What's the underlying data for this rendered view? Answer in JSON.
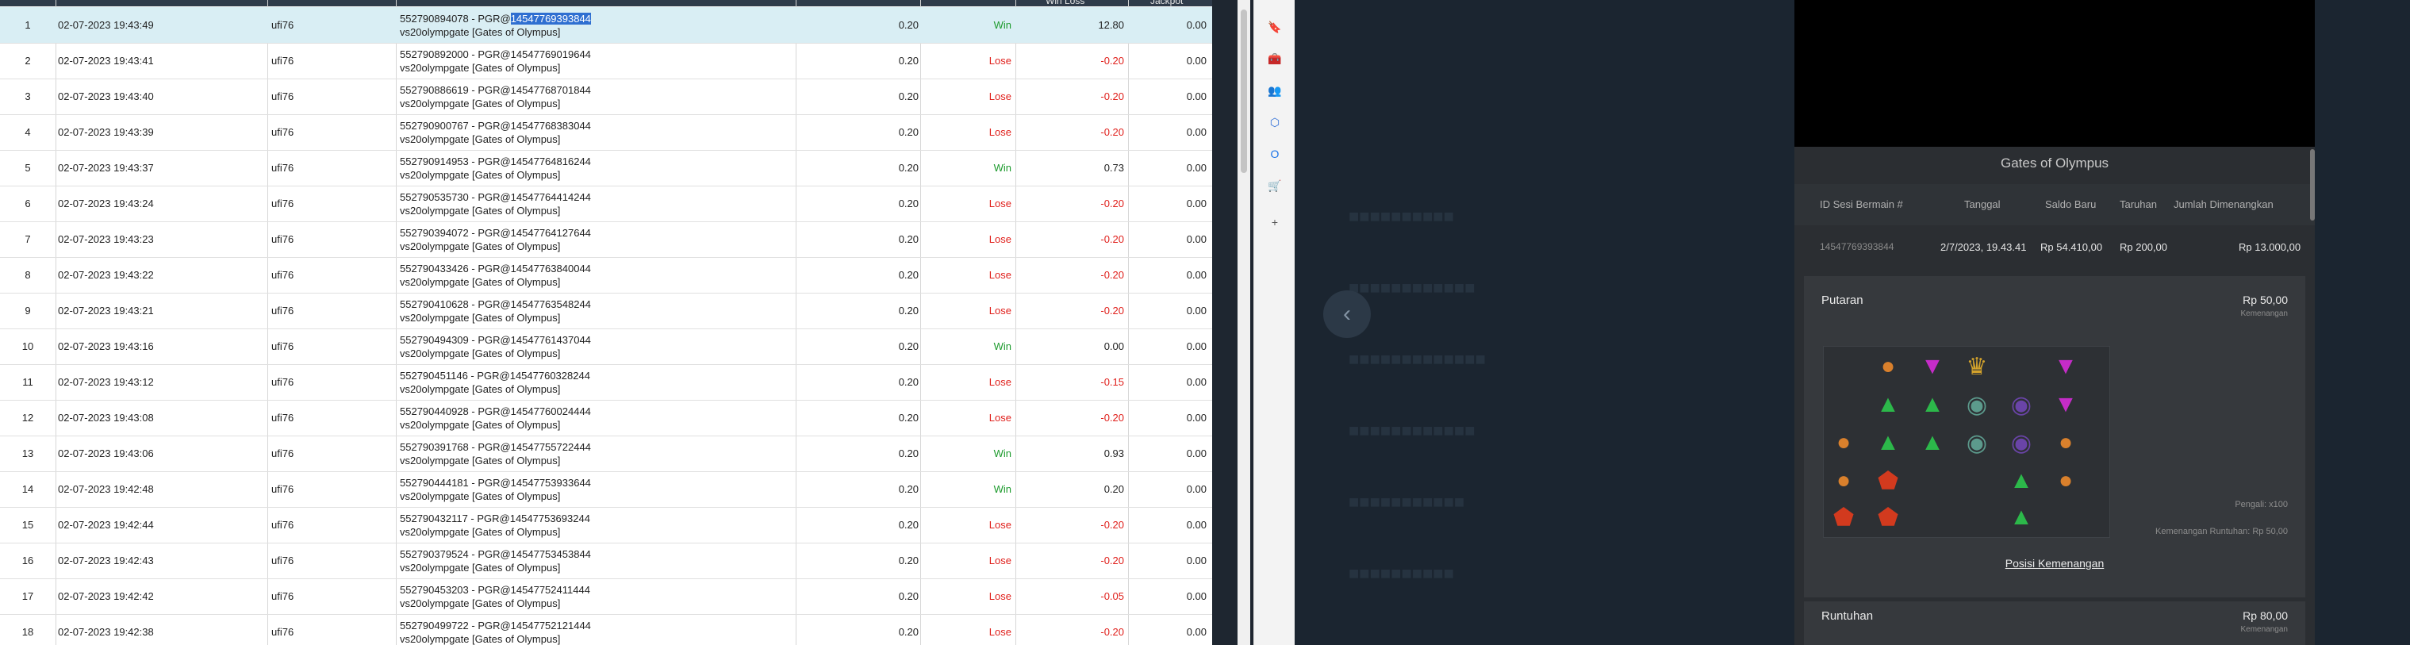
{
  "table": {
    "header": {
      "win_label": "Win Loss",
      "jp_label": "Jackpot"
    },
    "rows": [
      {
        "no": "1",
        "date": "02-07-2023 19:43:49",
        "user": "ufi76",
        "tx_pre": "552790894078 - PGR@",
        "tx_hl": "14547769393844",
        "tx2": "vs20olympgate [Gates of Olympus]",
        "bet": "0.20",
        "status": "Win",
        "win": "12.80",
        "jp": "0.00"
      },
      {
        "no": "2",
        "date": "02-07-2023 19:43:41",
        "user": "ufi76",
        "tx_pre": "552790892000 - PGR@14547769019644",
        "tx_hl": "",
        "tx2": "vs20olympgate [Gates of Olympus]",
        "bet": "0.20",
        "status": "Lose",
        "win": "-0.20",
        "jp": "0.00"
      },
      {
        "no": "3",
        "date": "02-07-2023 19:43:40",
        "user": "ufi76",
        "tx_pre": "552790886619 - PGR@14547768701844",
        "tx_hl": "",
        "tx2": "vs20olympgate [Gates of Olympus]",
        "bet": "0.20",
        "status": "Lose",
        "win": "-0.20",
        "jp": "0.00"
      },
      {
        "no": "4",
        "date": "02-07-2023 19:43:39",
        "user": "ufi76",
        "tx_pre": "552790900767 - PGR@14547768383044",
        "tx_hl": "",
        "tx2": "vs20olympgate [Gates of Olympus]",
        "bet": "0.20",
        "status": "Lose",
        "win": "-0.20",
        "jp": "0.00"
      },
      {
        "no": "5",
        "date": "02-07-2023 19:43:37",
        "user": "ufi76",
        "tx_pre": "552790914953 - PGR@14547764816244",
        "tx_hl": "",
        "tx2": "vs20olympgate [Gates of Olympus]",
        "bet": "0.20",
        "status": "Win",
        "win": "0.73",
        "jp": "0.00"
      },
      {
        "no": "6",
        "date": "02-07-2023 19:43:24",
        "user": "ufi76",
        "tx_pre": "552790535730 - PGR@14547764414244",
        "tx_hl": "",
        "tx2": "vs20olympgate [Gates of Olympus]",
        "bet": "0.20",
        "status": "Lose",
        "win": "-0.20",
        "jp": "0.00"
      },
      {
        "no": "7",
        "date": "02-07-2023 19:43:23",
        "user": "ufi76",
        "tx_pre": "552790394072 - PGR@14547764127644",
        "tx_hl": "",
        "tx2": "vs20olympgate [Gates of Olympus]",
        "bet": "0.20",
        "status": "Lose",
        "win": "-0.20",
        "jp": "0.00"
      },
      {
        "no": "8",
        "date": "02-07-2023 19:43:22",
        "user": "ufi76",
        "tx_pre": "552790433426 - PGR@14547763840044",
        "tx_hl": "",
        "tx2": "vs20olympgate [Gates of Olympus]",
        "bet": "0.20",
        "status": "Lose",
        "win": "-0.20",
        "jp": "0.00"
      },
      {
        "no": "9",
        "date": "02-07-2023 19:43:21",
        "user": "ufi76",
        "tx_pre": "552790410628 - PGR@14547763548244",
        "tx_hl": "",
        "tx2": "vs20olympgate [Gates of Olympus]",
        "bet": "0.20",
        "status": "Lose",
        "win": "-0.20",
        "jp": "0.00"
      },
      {
        "no": "10",
        "date": "02-07-2023 19:43:16",
        "user": "ufi76",
        "tx_pre": "552790494309 - PGR@14547761437044",
        "tx_hl": "",
        "tx2": "vs20olympgate [Gates of Olympus]",
        "bet": "0.20",
        "status": "Win",
        "win": "0.00",
        "jp": "0.00"
      },
      {
        "no": "11",
        "date": "02-07-2023 19:43:12",
        "user": "ufi76",
        "tx_pre": "552790451146 - PGR@14547760328244",
        "tx_hl": "",
        "tx2": "vs20olympgate [Gates of Olympus]",
        "bet": "0.20",
        "status": "Lose",
        "win": "-0.15",
        "jp": "0.00"
      },
      {
        "no": "12",
        "date": "02-07-2023 19:43:08",
        "user": "ufi76",
        "tx_pre": "552790440928 - PGR@14547760024444",
        "tx_hl": "",
        "tx2": "vs20olympgate [Gates of Olympus]",
        "bet": "0.20",
        "status": "Lose",
        "win": "-0.20",
        "jp": "0.00"
      },
      {
        "no": "13",
        "date": "02-07-2023 19:43:06",
        "user": "ufi76",
        "tx_pre": "552790391768 - PGR@14547755722444",
        "tx_hl": "",
        "tx2": "vs20olympgate [Gates of Olympus]",
        "bet": "0.20",
        "status": "Win",
        "win": "0.93",
        "jp": "0.00"
      },
      {
        "no": "14",
        "date": "02-07-2023 19:42:48",
        "user": "ufi76",
        "tx_pre": "552790444181 - PGR@14547753933644",
        "tx_hl": "",
        "tx2": "vs20olympgate [Gates of Olympus]",
        "bet": "0.20",
        "status": "Win",
        "win": "0.20",
        "jp": "0.00"
      },
      {
        "no": "15",
        "date": "02-07-2023 19:42:44",
        "user": "ufi76",
        "tx_pre": "552790432117 - PGR@14547753693244",
        "tx_hl": "",
        "tx2": "vs20olympgate [Gates of Olympus]",
        "bet": "0.20",
        "status": "Lose",
        "win": "-0.20",
        "jp": "0.00"
      },
      {
        "no": "16",
        "date": "02-07-2023 19:42:43",
        "user": "ufi76",
        "tx_pre": "552790379524 - PGR@14547753453844",
        "tx_hl": "",
        "tx2": "vs20olympgate [Gates of Olympus]",
        "bet": "0.20",
        "status": "Lose",
        "win": "-0.20",
        "jp": "0.00"
      },
      {
        "no": "17",
        "date": "02-07-2023 19:42:42",
        "user": "ufi76",
        "tx_pre": "552790453203 - PGR@14547752411444",
        "tx_hl": "",
        "tx2": "vs20olympgate [Gates of Olympus]",
        "bet": "0.20",
        "status": "Lose",
        "win": "-0.05",
        "jp": "0.00"
      },
      {
        "no": "18",
        "date": "02-07-2023 19:42:38",
        "user": "ufi76",
        "tx_pre": "552790499722 - PGR@14547752121444",
        "tx_hl": "",
        "tx2": "vs20olympgate [Gates of Olympus]",
        "bet": "0.20",
        "status": "Lose",
        "win": "-0.20",
        "jp": "0.00"
      }
    ]
  },
  "toolbar": {
    "icons": [
      "bookmark-icon",
      "toolbox-icon",
      "users-icon",
      "extension-icon",
      "outlook-icon",
      "cart-icon",
      "plus-icon"
    ],
    "glyphs": [
      "🔖",
      "🧰",
      "👥",
      "⬡",
      "O",
      "🛒",
      "+"
    ]
  },
  "game_modal": {
    "title": "Gates of Olympus",
    "headers": {
      "session_id": "ID Sesi Bermain #",
      "date": "Tanggal",
      "new_balance": "Saldo Baru",
      "bet": "Taruhan",
      "winnings": "Jumlah Dimenangkan"
    },
    "row": {
      "session_id": "14547769393844",
      "date": "2/7/2023, 19.43.41",
      "new_balance": "Rp 54.410,00",
      "bet": "Rp 200,00",
      "winnings": "Rp 13.000,00"
    },
    "putaran": {
      "title": "Putaran",
      "amount": "Rp 50,00",
      "amount_label": "Kemenangan",
      "multiplier": "Pengali: x100",
      "cascade_win": "Kemenangan Runtuhan: Rp 50,00",
      "link": "Posisi Kemenangan"
    },
    "runtuhan": {
      "title": "Runtuhan",
      "amount": "Rp 80,00",
      "amount_label": "Kemenangan"
    }
  }
}
